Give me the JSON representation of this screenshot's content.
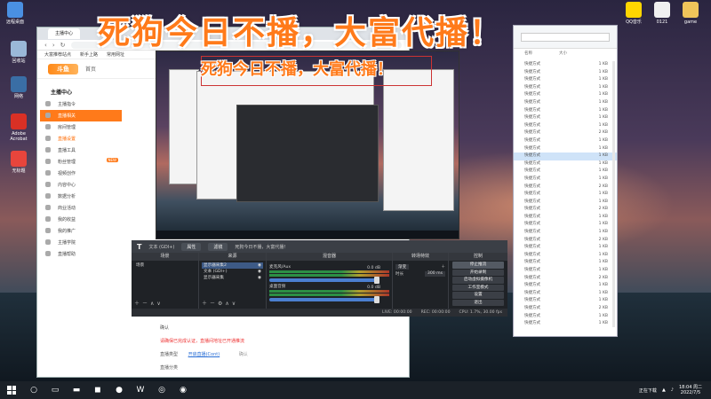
{
  "overlay": {
    "title": "死狗今日不播，大富代播！"
  },
  "desktop_left": [
    {
      "label": "远程桌面",
      "icon": "remote-desktop-icon",
      "color": "#4a90e2"
    },
    {
      "label": "回收站",
      "icon": "recycle-bin-icon",
      "color": "#9ab8d8"
    },
    {
      "label": "网络",
      "icon": "network-icon",
      "color": "#3a6ea5"
    },
    {
      "label": "Adobe Acrobat",
      "icon": "acrobat-icon",
      "color": "#d93025"
    },
    {
      "label": "无标题",
      "icon": "wps-icon",
      "color": "#e8453c"
    }
  ],
  "desktop_right": [
    {
      "label": "QQ音乐",
      "icon": "qq-music-icon",
      "color": "#ffd600"
    },
    {
      "label": "0121",
      "icon": "file-icon",
      "color": "#f0f0f0"
    },
    {
      "label": "game",
      "icon": "folder-icon",
      "color": "#f0c45a"
    }
  ],
  "browser": {
    "tab_title": "主播中心",
    "bookmarks": [
      "大富推荐站点",
      "新手上路",
      "常用网址"
    ],
    "logo": "斗鱼",
    "home_tab": "首页",
    "sidebar": {
      "title": "主播中心",
      "items": [
        {
          "label": "主播指令",
          "state": "normal"
        },
        {
          "label": "直播相关",
          "state": "active"
        },
        {
          "label": "房间管理",
          "state": "normal"
        },
        {
          "label": "直播设置",
          "state": "orange"
        },
        {
          "label": "直播工具",
          "state": "normal"
        },
        {
          "label": "粉丝管理",
          "state": "normal",
          "badge": "NEW"
        },
        {
          "label": "视频创作",
          "state": "normal"
        },
        {
          "label": "内容中心",
          "state": "normal"
        },
        {
          "label": "数据分析",
          "state": "normal"
        },
        {
          "label": "商业活动",
          "state": "normal"
        },
        {
          "label": "我的收益",
          "state": "normal"
        },
        {
          "label": "我的推广",
          "state": "normal"
        },
        {
          "label": "主播学院",
          "state": "normal"
        },
        {
          "label": "直播帮助",
          "state": "normal"
        }
      ]
    },
    "form": {
      "line1": "确认",
      "line2": "请确保已完成认证，直播间地址已开通推流",
      "line3_label": "直播类型",
      "line3_link": "开启直播(Cont)",
      "line3_ghost": "确认",
      "line4": "直播分类"
    }
  },
  "explorer": {
    "col_name": "名称",
    "col_size": "大小",
    "rows": [
      {
        "name": "快捷方式",
        "size": "1 KB"
      },
      {
        "name": "快捷方式",
        "size": "1 KB"
      },
      {
        "name": "快捷方式",
        "size": "1 KB"
      },
      {
        "name": "快捷方式",
        "size": "1 KB"
      },
      {
        "name": "快捷方式",
        "size": "1 KB"
      },
      {
        "name": "快捷方式",
        "size": "1 KB"
      },
      {
        "name": "快捷方式",
        "size": "1 KB"
      },
      {
        "name": "快捷方式",
        "size": "1 KB"
      },
      {
        "name": "快捷方式",
        "size": "1 KB"
      },
      {
        "name": "快捷方式",
        "size": "2 KB"
      },
      {
        "name": "快捷方式",
        "size": "1 KB"
      },
      {
        "name": "快捷方式",
        "size": "1 KB"
      },
      {
        "name": "快捷方式",
        "size": "1 KB",
        "selected": true
      },
      {
        "name": "快捷方式",
        "size": "1 KB"
      },
      {
        "name": "快捷方式",
        "size": "1 KB"
      },
      {
        "name": "快捷方式",
        "size": "1 KB"
      },
      {
        "name": "快捷方式",
        "size": "2 KB"
      },
      {
        "name": "快捷方式",
        "size": "1 KB"
      },
      {
        "name": "快捷方式",
        "size": "1 KB"
      },
      {
        "name": "快捷方式",
        "size": "2 KB"
      },
      {
        "name": "快捷方式",
        "size": "1 KB"
      },
      {
        "name": "快捷方式",
        "size": "1 KB"
      },
      {
        "name": "快捷方式",
        "size": "1 KB"
      },
      {
        "name": "快捷方式",
        "size": "2 KB"
      },
      {
        "name": "快捷方式",
        "size": "1 KB"
      },
      {
        "name": "快捷方式",
        "size": "1 KB"
      },
      {
        "name": "快捷方式",
        "size": "1 KB"
      },
      {
        "name": "快捷方式",
        "size": "1 KB"
      },
      {
        "name": "快捷方式",
        "size": "2 KB"
      },
      {
        "name": "快捷方式",
        "size": "1 KB"
      },
      {
        "name": "快捷方式",
        "size": "1 KB"
      },
      {
        "name": "快捷方式",
        "size": "1 KB"
      },
      {
        "name": "快捷方式",
        "size": "2 KB"
      },
      {
        "name": "快捷方式",
        "size": "1 KB"
      },
      {
        "name": "快捷方式",
        "size": "1 KB"
      }
    ]
  },
  "preview": {
    "title": "死狗今日不播，大富代播！"
  },
  "obs": {
    "toolbar_label": "文本 (GDI+)",
    "properties_label": "属性",
    "filters_label": "滤镜",
    "text_field": "死狗今日不播，大富代播！",
    "scenes_title": "场景",
    "sources_title": "来源",
    "mixer_title": "混音器",
    "transitions_title": "转场特效",
    "controls_title": "控制",
    "scene_items": [
      "场景"
    ],
    "source_items": [
      "显示器采集2",
      "文本 (GDI+)",
      "显示器采集"
    ],
    "mixer": [
      {
        "name": "麦克风/Aux",
        "db": "0.0 dB"
      },
      {
        "name": "桌面音频",
        "db": "0.0 dB"
      }
    ],
    "transition_type": "渐变",
    "duration_label": "时长",
    "duration_value": "300 ms",
    "controls": [
      {
        "label": "停止推流",
        "active": true
      },
      {
        "label": "开始录制",
        "active": false
      },
      {
        "label": "启动虚拟摄像机",
        "active": false
      },
      {
        "label": "工作室模式",
        "active": false
      },
      {
        "label": "设置",
        "active": false
      },
      {
        "label": "退出",
        "active": false
      }
    ],
    "status": {
      "live": "LIVE: 00:00:00",
      "rec": "REC: 00:00:00",
      "cpu": "CPU: 1.7%, 30.00 fps"
    }
  },
  "taskbar": {
    "apps": [
      {
        "icon": "search-icon",
        "glyph": "○"
      },
      {
        "icon": "task-view-icon",
        "glyph": "▭"
      },
      {
        "icon": "explorer-icon",
        "glyph": "▬"
      },
      {
        "icon": "store-icon",
        "glyph": "◼"
      },
      {
        "icon": "wechat-icon",
        "glyph": "●"
      },
      {
        "icon": "wps-icon",
        "glyph": "W"
      },
      {
        "icon": "obs-icon",
        "glyph": "◎"
      },
      {
        "icon": "firefox-icon",
        "glyph": "◉"
      }
    ],
    "tray_text": "正在下载",
    "time": "18:04 周二",
    "date": "2022/7/5"
  }
}
